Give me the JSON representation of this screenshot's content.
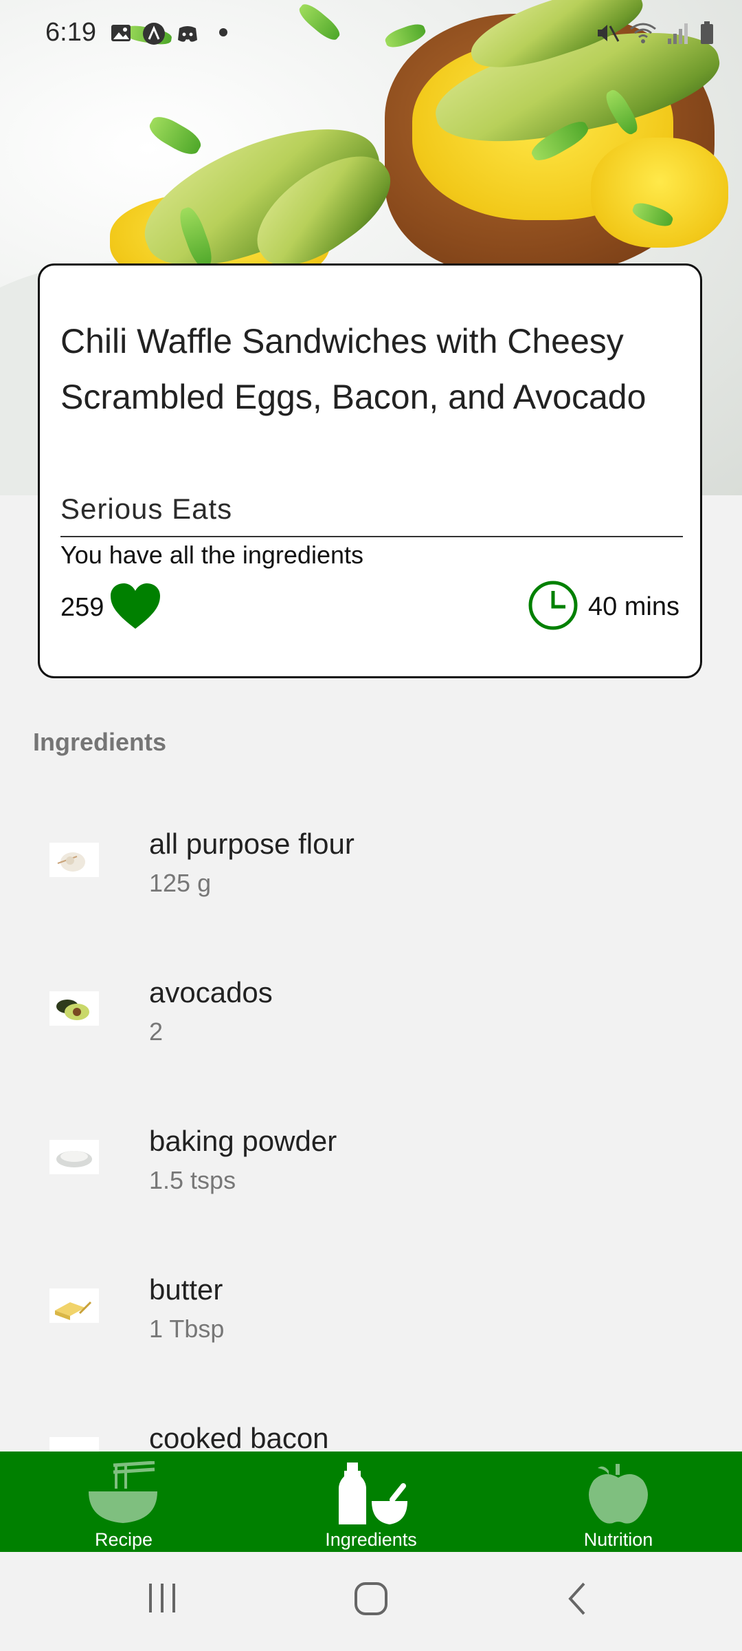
{
  "status_bar": {
    "time": "6:19",
    "left_icons": [
      "gallery-icon",
      "app-icon",
      "discord-icon",
      "dot-icon"
    ],
    "right_icons": [
      "mute-icon",
      "wifi-icon",
      "signal-icon",
      "battery-icon"
    ]
  },
  "recipe": {
    "title": "Chili Waffle Sandwiches with Cheesy Scrambled Eggs, Bacon, and Avocado",
    "source": "Serious Eats",
    "ingredient_status": "You have all the ingredients",
    "likes": "259",
    "time": "40 mins"
  },
  "ingredients": {
    "header": "Ingredients",
    "items": [
      {
        "name": "all purpose flour",
        "amount": "125 g",
        "thumb": "flour"
      },
      {
        "name": "avocados",
        "amount": "2",
        "thumb": "avocado"
      },
      {
        "name": "baking powder",
        "amount": "1.5 tsps",
        "thumb": "powder"
      },
      {
        "name": "butter",
        "amount": "1 Tbsp",
        "thumb": "butter"
      },
      {
        "name": "cooked bacon",
        "amount": "",
        "thumb": "bacon"
      }
    ]
  },
  "bottom_nav": {
    "items": [
      {
        "label": "Recipe",
        "icon": "noodle-bowl-icon"
      },
      {
        "label": "Ingredients",
        "icon": "bottle-mortar-icon"
      },
      {
        "label": "Nutrition",
        "icon": "apple-icon"
      }
    ]
  },
  "colors": {
    "accent": "#008000",
    "background": "#f2f2f2",
    "card_border": "#111111"
  }
}
